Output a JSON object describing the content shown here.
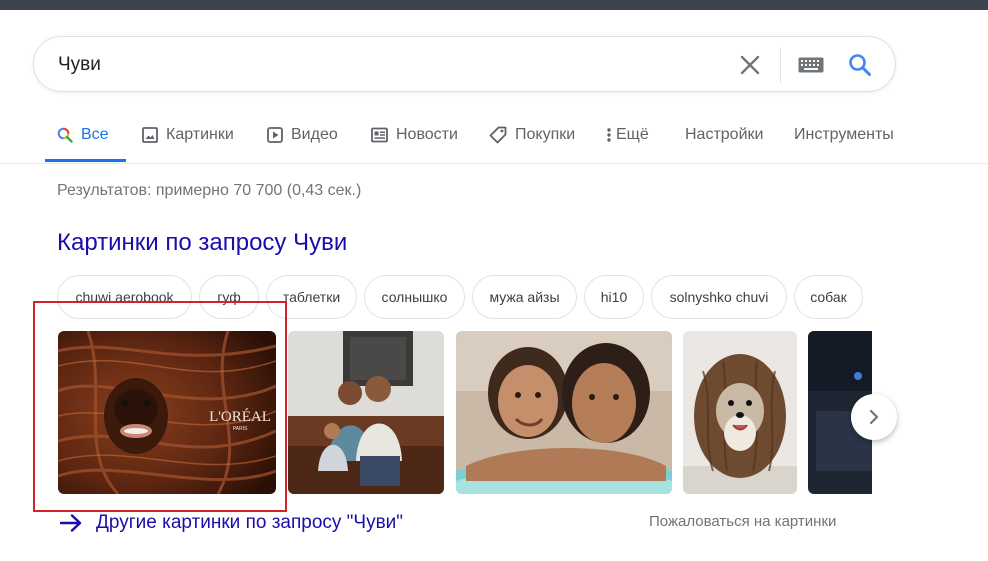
{
  "search": {
    "query": "Чуви"
  },
  "tabs": [
    {
      "label": "Все",
      "icon": "search-icon",
      "active": true
    },
    {
      "label": "Картинки",
      "icon": "image-icon"
    },
    {
      "label": "Видео",
      "icon": "play-icon"
    },
    {
      "label": "Новости",
      "icon": "news-icon"
    },
    {
      "label": "Покупки",
      "icon": "tag-icon"
    },
    {
      "label": "Ещё",
      "icon": "more-vert-icon"
    },
    {
      "label": "Настройки"
    },
    {
      "label": "Инструменты"
    }
  ],
  "results_stats": "Результатов: примерно 70 700 (0,43 сек.)",
  "images_section": {
    "title": "Картинки по запросу Чуви",
    "chips": [
      "chuwi aerobook",
      "гуф",
      "таблетки",
      "солнышко",
      "мужа айзы",
      "hi10",
      "solnyshko chuvi",
      "собак"
    ],
    "thumbnail_text": "L'ORÉAL",
    "thumbnail_subtext": "PARIS",
    "more_link": "Другие картинки по запросу \"Чуви\"",
    "report_link": "Пожаловаться на картинки"
  },
  "colors": {
    "accent": "#1a73e8",
    "link": "#1a0dab",
    "highlight": "#d2232a",
    "top_strip": "#3c4350"
  }
}
